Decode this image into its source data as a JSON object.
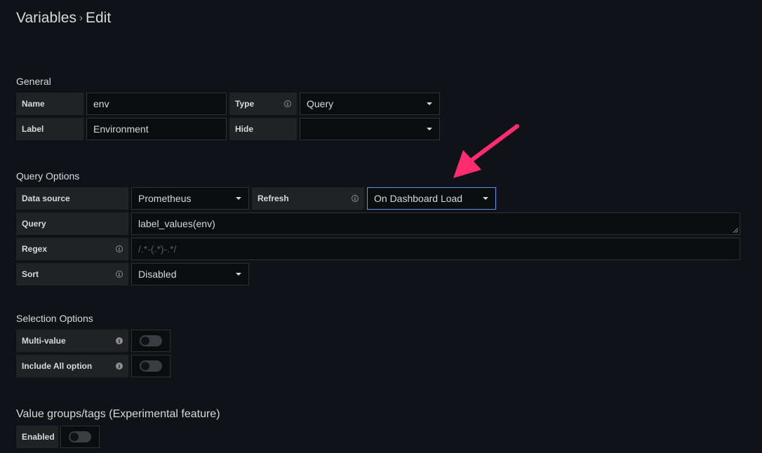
{
  "header": {
    "breadcrumb_root": "Variables",
    "separator": "›",
    "current": "Edit"
  },
  "general": {
    "section_title": "General",
    "name_label": "Name",
    "name_value": "env",
    "type_label": "Type",
    "type_value": "Query",
    "label_label": "Label",
    "label_value": "Environment",
    "hide_label": "Hide",
    "hide_value": ""
  },
  "query_options": {
    "section_title": "Query Options",
    "datasource_label": "Data source",
    "datasource_value": "Prometheus",
    "refresh_label": "Refresh",
    "refresh_value": "On Dashboard Load",
    "query_label": "Query",
    "query_value": "label_values(env)",
    "regex_label": "Regex",
    "regex_placeholder": "/.*-(.*)-.*/",
    "sort_label": "Sort",
    "sort_value": "Disabled"
  },
  "selection_options": {
    "section_title": "Selection Options",
    "multi_value_label": "Multi-value",
    "multi_value_on": false,
    "include_all_label": "Include All option",
    "include_all_on": false
  },
  "value_groups": {
    "section_title": "Value groups/tags (Experimental feature)",
    "enabled_label": "Enabled",
    "enabled_on": false
  },
  "colors": {
    "background": "#111217",
    "label_bg": "#202226",
    "input_bg": "#0b0c0e",
    "focus_border": "#5794f2",
    "annotation_arrow": "#ff2d6f"
  }
}
